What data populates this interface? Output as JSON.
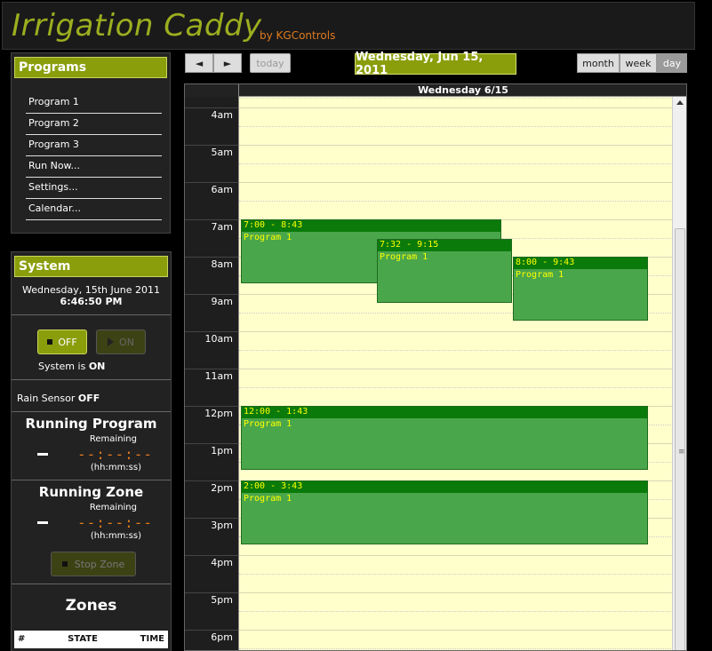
{
  "header": {
    "title": "Irrigation Caddy",
    "byline": "by KGControls"
  },
  "programs": {
    "heading": "Programs",
    "items": [
      {
        "label": "Program 1"
      },
      {
        "label": "Program 2"
      },
      {
        "label": "Program 3"
      },
      {
        "label": "Run Now..."
      },
      {
        "label": "Settings..."
      },
      {
        "label": "Calendar..."
      }
    ]
  },
  "system": {
    "heading": "System",
    "date": "Wednesday, 15th June 2011",
    "time": "6:46:50 PM",
    "off_label": "OFF",
    "on_label": "ON",
    "status_prefix": "System is",
    "status_value": "ON",
    "rain_prefix": "Rain Sensor",
    "rain_value": "OFF"
  },
  "running_program": {
    "title": "Running Program",
    "remaining_label": "Remaining",
    "value": "-",
    "timer": "--:--:--",
    "format": "(hh:mm:ss)"
  },
  "running_zone": {
    "title": "Running Zone",
    "remaining_label": "Remaining",
    "value": "-",
    "timer": "--:--:--",
    "format": "(hh:mm:ss)",
    "stop_label": "Stop Zone"
  },
  "zones": {
    "title": "Zones",
    "columns": [
      "#",
      "STATE",
      "TIME"
    ]
  },
  "calendar": {
    "prev_icon": "◄",
    "next_icon": "►",
    "today_label": "today",
    "title": "Wednesday, Jun 15, 2011",
    "views": [
      "month",
      "week",
      "day"
    ],
    "active_view": "day",
    "column_header": "Wednesday 6/15",
    "hours": [
      "4am",
      "5am",
      "6am",
      "7am",
      "8am",
      "9am",
      "10am",
      "11am",
      "12pm",
      "1pm",
      "2pm",
      "3pm",
      "4pm",
      "5pm",
      "6pm"
    ],
    "events": [
      {
        "time": "7:00 - 8:43",
        "title": "Program 1"
      },
      {
        "time": "7:32 - 9:15",
        "title": "Program 1"
      },
      {
        "time": "8:00 - 9:43",
        "title": "Program 1"
      },
      {
        "time": "12:00 - 1:43",
        "title": "Program 1"
      },
      {
        "time": "2:00 - 3:43",
        "title": "Program 1"
      }
    ]
  },
  "colors": {
    "accent": "#8a9e0c",
    "title": "#9cae1f",
    "byline": "#e07a1f",
    "event_fill": "#4aa64a",
    "event_head": "#0a7a0a",
    "event_text": "#ffff00",
    "calendar_bg": "#ffffcc"
  }
}
